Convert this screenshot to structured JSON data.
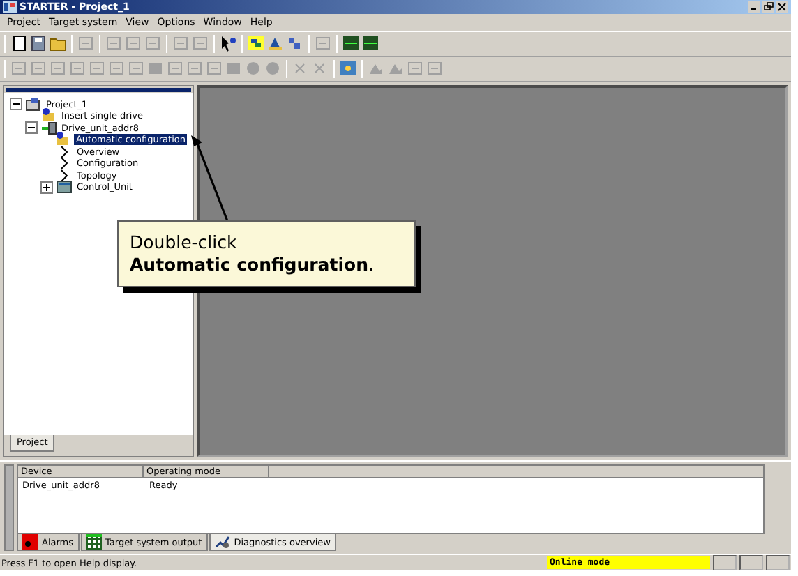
{
  "window": {
    "title": "STARTER - Project_1"
  },
  "menu": [
    "Project",
    "Target system",
    "View",
    "Options",
    "Window",
    "Help"
  ],
  "tree": [
    {
      "label": "Project_1",
      "kind": "project",
      "expanded": true,
      "selected": false,
      "children": [
        {
          "label": "Insert single drive",
          "kind": "insert",
          "selected": false
        },
        {
          "label": "Drive_unit_addr8",
          "kind": "drive",
          "expanded": true,
          "selected": false,
          "children": [
            {
              "label": "Automatic configuration",
              "kind": "insert",
              "selected": true
            },
            {
              "label": "Overview",
              "kind": "chevron",
              "selected": false
            },
            {
              "label": "Configuration",
              "kind": "chevron",
              "selected": false
            },
            {
              "label": "Topology",
              "kind": "chevron",
              "selected": false
            },
            {
              "label": "Control_Unit",
              "kind": "unit",
              "expanded": false,
              "selected": false
            }
          ]
        }
      ]
    }
  ],
  "left_tabs": [
    {
      "label": "Project",
      "selected": true
    }
  ],
  "callout": {
    "text": "Double-click\n**Automatic configuration**."
  },
  "table": {
    "columns": [
      "Device",
      "Operating mode"
    ],
    "rows": [
      [
        "Drive_unit_addr8",
        "Ready"
      ]
    ]
  },
  "bottom_tabs": [
    {
      "label": "Alarms",
      "kind": "alarm",
      "selected": false
    },
    {
      "label": "Target system output",
      "kind": "grid",
      "selected": false
    },
    {
      "label": "Diagnostics overview",
      "kind": "diag",
      "selected": true
    }
  ],
  "status_bar": {
    "help": "Press F1 to open Help display.",
    "mode": "Online mode"
  }
}
